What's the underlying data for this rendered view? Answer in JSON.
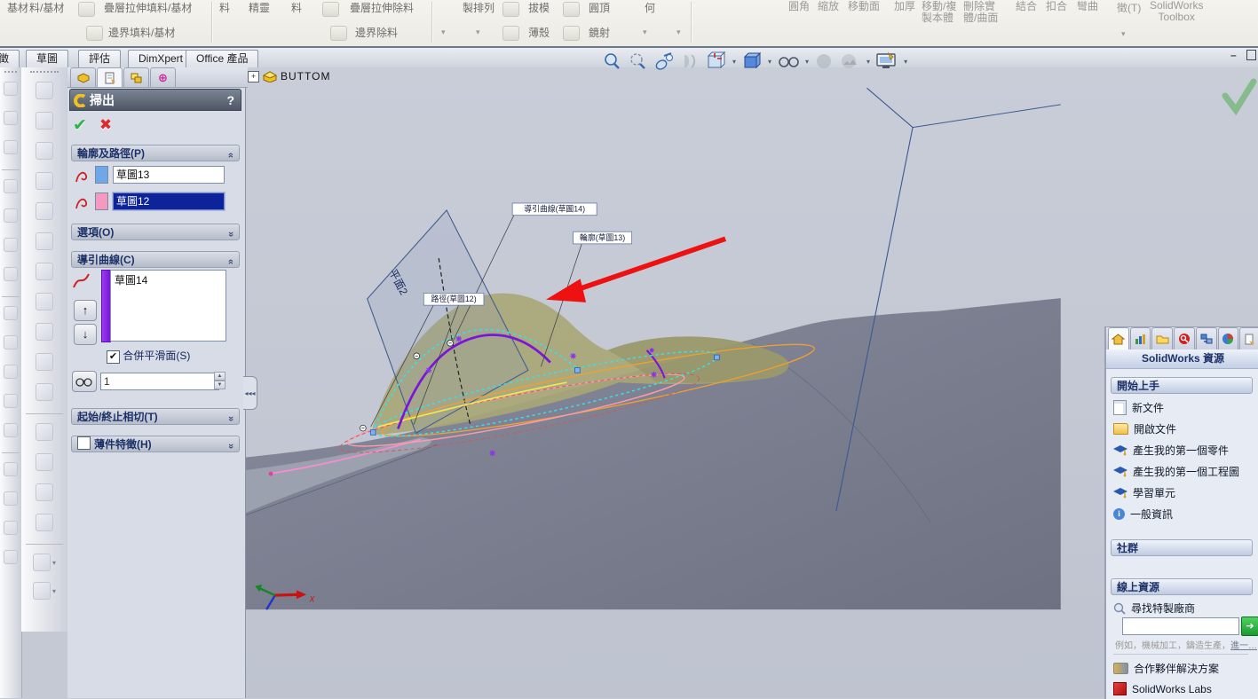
{
  "icons": {
    "help": "?",
    "ok": "✔",
    "cancel": "✖",
    "check": "✔",
    "chevrons": "»",
    "dropdown": "▾",
    "expand": "+",
    "up_arrow": "↑",
    "down_arrow": "↓",
    "go_arrow": "➔",
    "minimize": "–",
    "left_arrows": "◂◂◂",
    "spin_up": "▲",
    "spin_down": "▼",
    "info_i": "i",
    "crosshair": "⊕"
  },
  "ribbon": {
    "labels": [
      "基材",
      "料/基材",
      "疊層拉伸填料/基材",
      "邊界填料/基材",
      "料",
      "精靈",
      "料",
      "疊層拉伸除料",
      "邊界除料",
      "製排列",
      "拔模",
      "薄殼",
      "圓頂",
      "鏡射",
      "何",
      "圓角",
      "縮放",
      "移動面",
      "加厚",
      "移動/複\n製本體",
      "刪除實\n體/曲面",
      "結合",
      "扣合",
      "彎曲",
      "徵(T)",
      "SolidWorks\nToolbox"
    ]
  },
  "tabs": [
    "徵",
    "草圖",
    "評估",
    "DimXpert",
    "Office 產品"
  ],
  "pm": {
    "title": "掃出",
    "profile_path_header": "輪廓及路徑(P)",
    "profile_value": "草圖13",
    "path_value": "草圖12",
    "options_header": "選項(O)",
    "guide_header": "導引曲線(C)",
    "guide_value": "草圖14",
    "merge_label": "合併平滑面(S)",
    "merge_checked": true,
    "spinner_value": "1",
    "tangency_header": "起始/終止相切(T)",
    "thin_header": "薄件特徵(H)",
    "thin_checked": false
  },
  "viewport": {
    "tree_label": "BUTTOM",
    "callout_guide": "導引曲線(草圖14)",
    "callout_profile": "輪廓(草圖13)",
    "callout_path": "路徑(草圖12)",
    "plane_label": "平面2",
    "axis_x": "X"
  },
  "taskpane": {
    "title": "SolidWorks 資源",
    "getting_started": "開始上手",
    "items": [
      "新文件",
      "開啟文件",
      "產生我的第一個零件",
      "產生我的第一個工程圖",
      "學習單元",
      "一般資訊"
    ],
    "community": "社群",
    "online": "線上資源",
    "search_label": "尋找特製廠商",
    "search_hint": "例如，機械加工，鑄造生產，",
    "search_hint_link": "進一…",
    "partner": "合作夥伴解決方案",
    "labs": "SolidWorks Labs"
  },
  "colors": {
    "accent_navy": "#1d3168",
    "selection_blue": "#0c2399",
    "guide_purple": "#7a16d8",
    "sweep_olive": "#a8a677",
    "surface_gray": "#7b7f8e",
    "arrow_red": "#ee1111",
    "profile_swatch_blue": "#6fa8e8",
    "path_swatch_pink": "#f49ac1"
  }
}
